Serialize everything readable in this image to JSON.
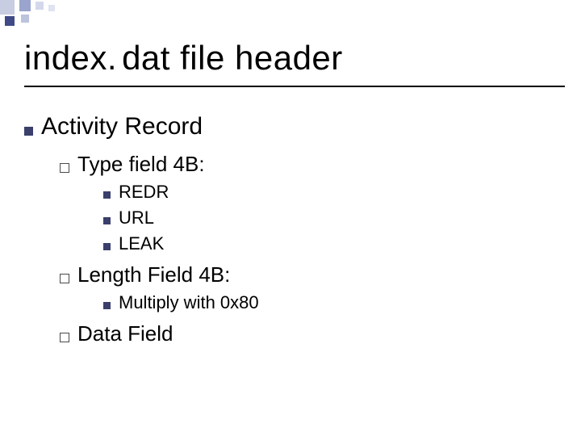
{
  "title_a": "index.",
  "title_b": "dat file header",
  "lvl1": {
    "text": "Activity Record"
  },
  "type_field": {
    "label": "Type field 4B:",
    "items": [
      "REDR",
      "URL",
      "LEAK"
    ]
  },
  "length_field": {
    "label": "Length Field 4B:",
    "items": [
      "Multiply with 0x80"
    ]
  },
  "data_field": {
    "label": "Data Field"
  }
}
